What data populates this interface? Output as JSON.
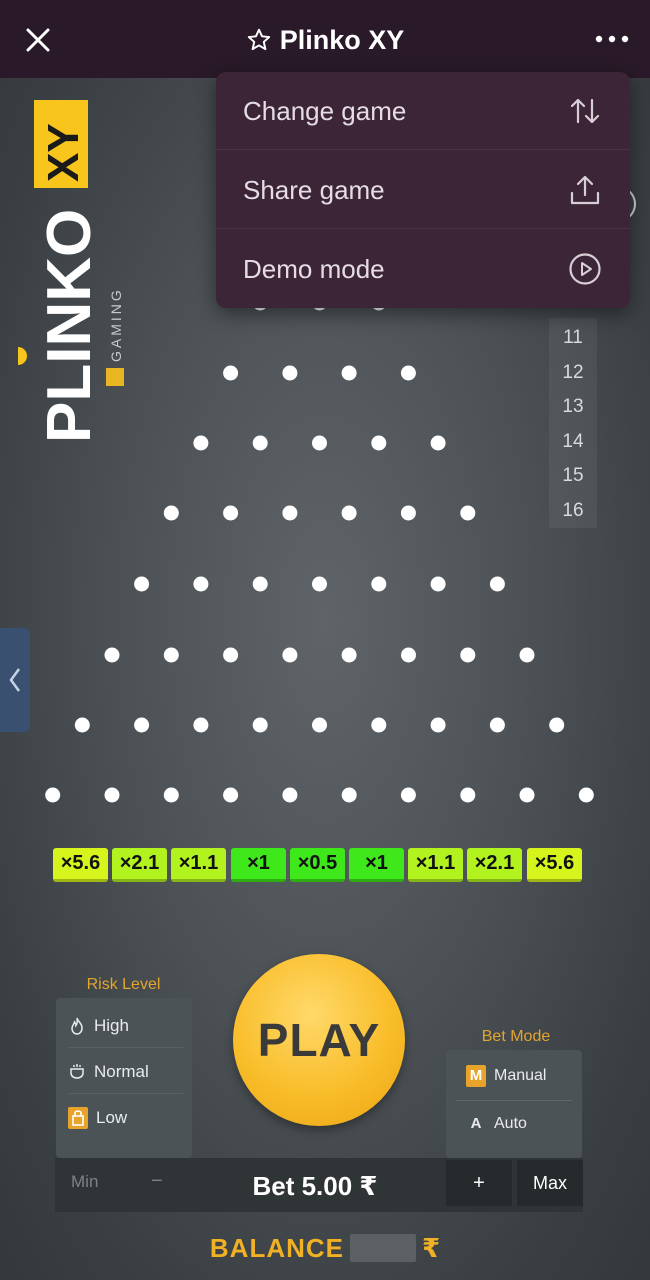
{
  "header": {
    "title": "Plinko XY",
    "close_icon": "close-icon",
    "favorite_icon": "star-outline-icon",
    "more_icon": "more-horizontal-icon"
  },
  "menu": {
    "items": [
      {
        "label": "Change game",
        "icon": "swap-vertical-icon"
      },
      {
        "label": "Share game",
        "icon": "share-upload-icon"
      },
      {
        "label": "Demo mode",
        "icon": "play-circle-icon"
      }
    ]
  },
  "logo": {
    "text": "PLINKO XY",
    "brand": "BGAMING"
  },
  "rows": {
    "visible_numbers": [
      "11",
      "12",
      "13",
      "14",
      "15",
      "16"
    ]
  },
  "multipliers": [
    "×5.6",
    "×2.1",
    "×1.1",
    "×1",
    "×0.5",
    "×1",
    "×1.1",
    "×2.1",
    "×5.6"
  ],
  "risk": {
    "label": "Risk Level",
    "options": [
      {
        "label": "High",
        "icon": "flame-icon"
      },
      {
        "label": "Normal",
        "icon": "cup-icon"
      },
      {
        "label": "Low",
        "icon": "lock-icon",
        "selected": true
      }
    ]
  },
  "play": {
    "label": "PLAY"
  },
  "bet_mode": {
    "label": "Bet Mode",
    "options": [
      {
        "label": "Manual",
        "badge": "M",
        "selected": true
      },
      {
        "label": "Auto",
        "badge": "A"
      }
    ]
  },
  "bet": {
    "min_label": "Min",
    "minus_label": "−",
    "amount": "Bet 5.00 ₹",
    "plus_label": "+",
    "max_label": "Max"
  },
  "balance": {
    "label": "BALANCE",
    "currency": "₹"
  },
  "colors": {
    "topbar": "#2a1a29",
    "menu_bg": "#3b2537",
    "accent": "#f1b124",
    "mult_yellow": "#d6f51c",
    "mult_green": "#3ee81a"
  }
}
